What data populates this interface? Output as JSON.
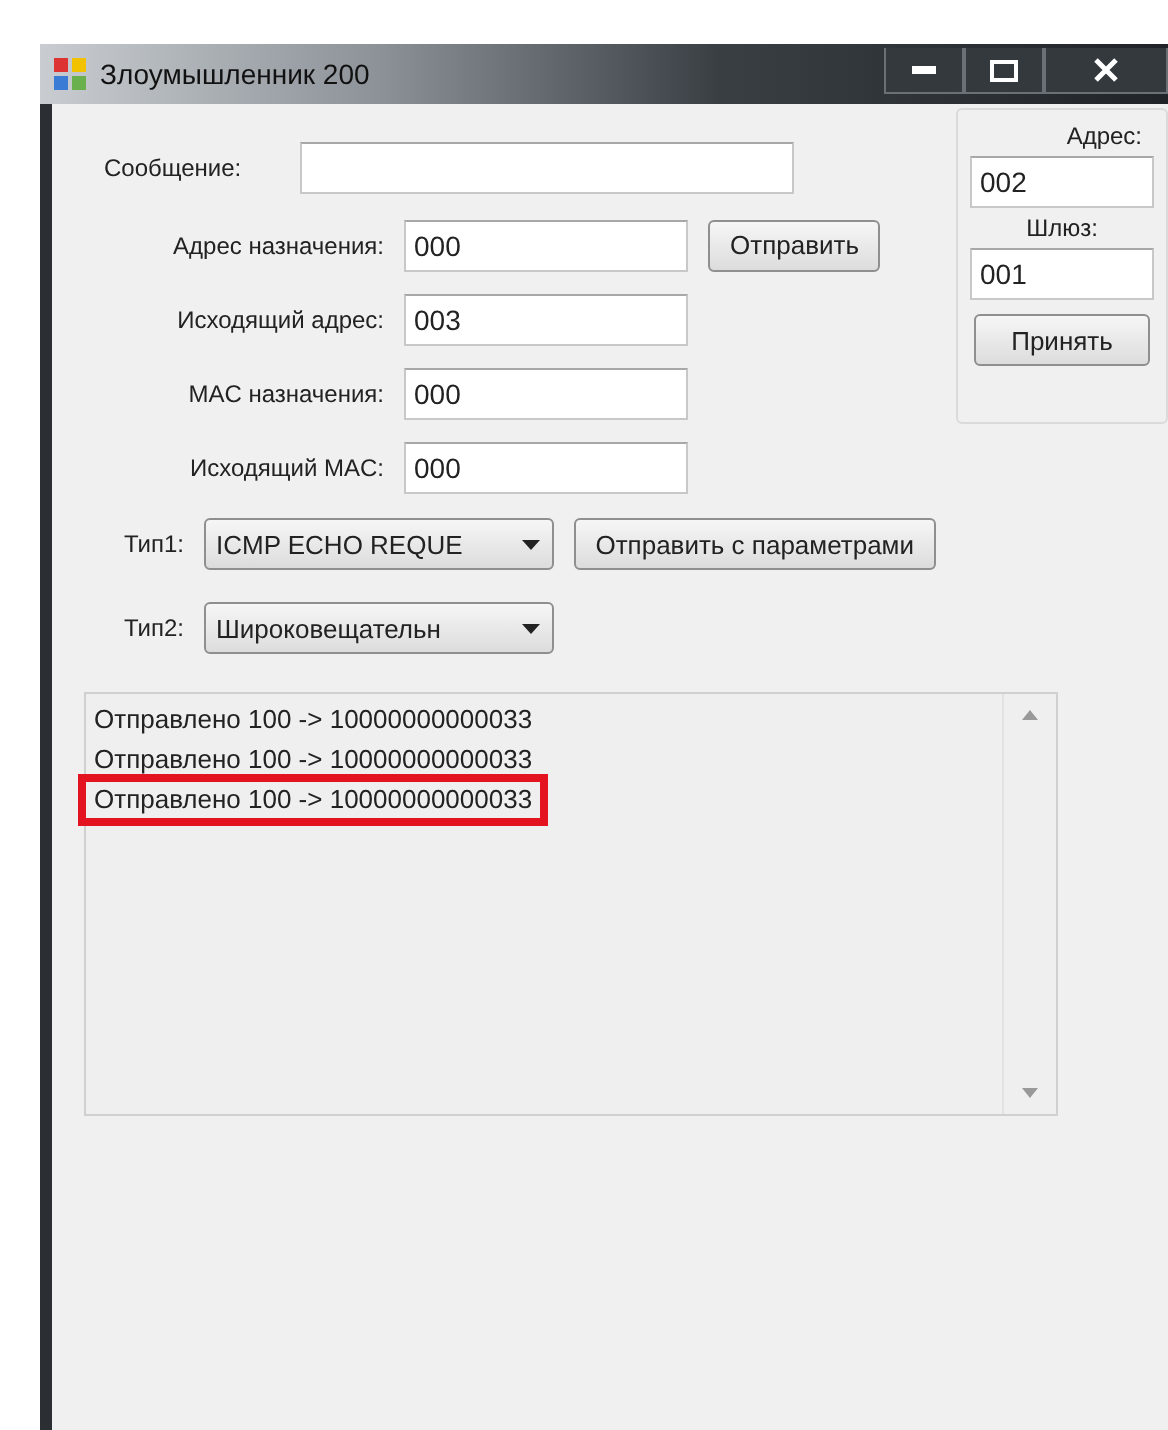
{
  "window": {
    "title": "Злоумышленник 200"
  },
  "message": {
    "label": "Сообщение:"
  },
  "fields": [
    {
      "label": "Адрес назначения:",
      "value": "000"
    },
    {
      "label": "Исходящий адрес:",
      "value": "003"
    },
    {
      "label": "MAC назначения:",
      "value": "000"
    },
    {
      "label": "Исходящий MAC:",
      "value": "000"
    }
  ],
  "send_button": "Отправить",
  "settings": {
    "address_label": "Адрес:",
    "address": "002",
    "gateway_label": "Шлюз:",
    "gateway": "001",
    "apply_button": "Принять"
  },
  "type1": {
    "label": "Тип1:",
    "value": "ICMP ECHO REQUE"
  },
  "send_params_button": "Отправить с параметрами",
  "type2": {
    "label": "Тип2:",
    "value": "Широковещательн"
  },
  "log": [
    {
      "text": "Отправлено 100 -> 10000000000033",
      "highlighted": false
    },
    {
      "text": "Отправлено 100 -> 10000000000033",
      "highlighted": false
    },
    {
      "text": "Отправлено 100 -> 10000000000033",
      "highlighted": true
    }
  ]
}
